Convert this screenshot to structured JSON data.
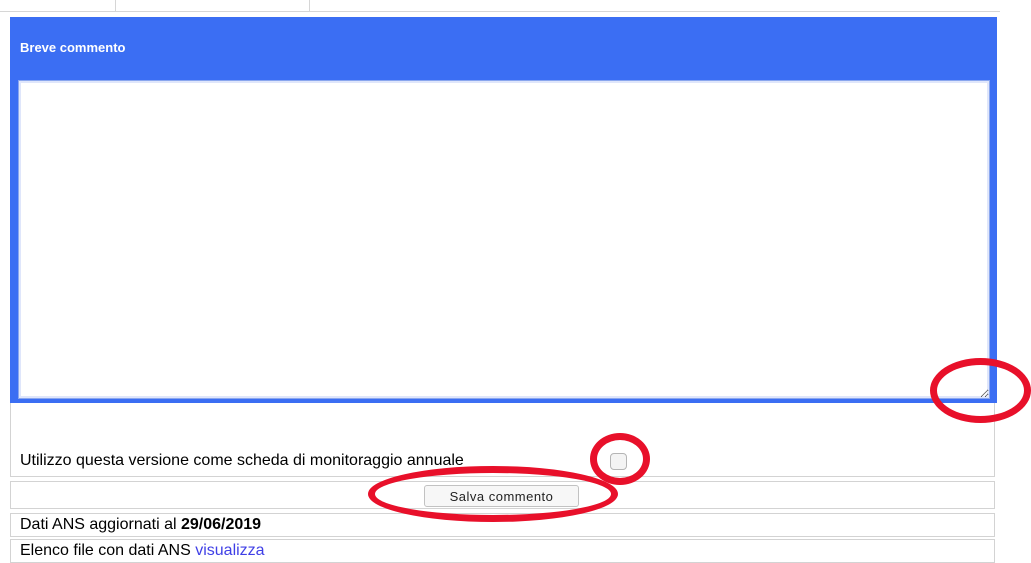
{
  "comment_section": {
    "title": "Breve commento",
    "textarea_value": ""
  },
  "annual_monitoring": {
    "label": "Utilizzo questa versione come scheda di monitoraggio annuale",
    "checked": false
  },
  "save": {
    "label": "Salva commento"
  },
  "ans_update": {
    "prefix": "Dati ANS aggiornati al ",
    "date": "29/06/2019"
  },
  "ans_files": {
    "prefix": "Elenco file con dati ANS ",
    "link_label": "visualizza"
  },
  "colors": {
    "header_blue": "#3b6ef3",
    "annotation_red": "#e8102a",
    "link_blue": "#3f3fe6"
  }
}
